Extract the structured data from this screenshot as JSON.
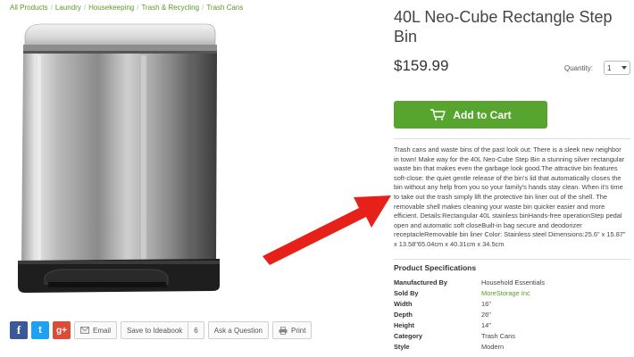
{
  "breadcrumb": [
    "All Products",
    "Laundry",
    "Housekeeping",
    "Trash & Recycling",
    "Trash Cans"
  ],
  "product": {
    "title": "40L Neo-Cube Rectangle Step Bin",
    "price": "$159.99",
    "quantity_label": "Quantity:",
    "quantity_value": "1",
    "add_to_cart_label": "Add to Cart",
    "description": "Trash cans and waste bins of the past look out: There is a sleek new neighbor in town! Make way for the 40L Neo-Cube Step Bin a stunning silver rectangular waste bin that makes even the garbage look good.The attractive bin features soft-close: the quiet gentle release of the bin's lid that automatically closes the bin without any help from you so your family's hands stay clean. When it's time to take out the trash simply lift the protective bin liner out of the shell. The removable shell makes cleaning your waste bin quicker easier and more efficient. Details:Rectangular 40L stainless binHands-free operationStep pedal open and automatic soft closeBuilt-in bag secure and deodorizer receptacleRemovable bin liner Color: Stainless steel Dimensions:25.6\" x 15.87\" x 13.58\"65.04cm x 40.31cm x 34.5cm"
  },
  "specs": {
    "title": "Product Specifications",
    "rows": [
      {
        "key": "Manufactured By",
        "value": "Household Essentials"
      },
      {
        "key": "Sold By",
        "value": "MoreStorage Inc"
      },
      {
        "key": "Width",
        "value": "16\""
      },
      {
        "key": "Depth",
        "value": "26\""
      },
      {
        "key": "Height",
        "value": "14\""
      },
      {
        "key": "Category",
        "value": "Trash Cans"
      },
      {
        "key": "Style",
        "value": "Modern"
      }
    ]
  },
  "share": {
    "facebook": "f",
    "twitter": "t",
    "googleplus": "g+",
    "email": "Email",
    "ideabook": "Save to Ideabook",
    "ideabook_count": "6",
    "ask": "Ask a Question",
    "print": "Print"
  },
  "colors": {
    "accent_green": "#57a42f",
    "link_green": "#5a9a24",
    "annotation_arrow": "#e8201a"
  },
  "icons": [
    "cart-icon",
    "mail-icon",
    "printer-icon",
    "chevron-down-icon"
  ]
}
